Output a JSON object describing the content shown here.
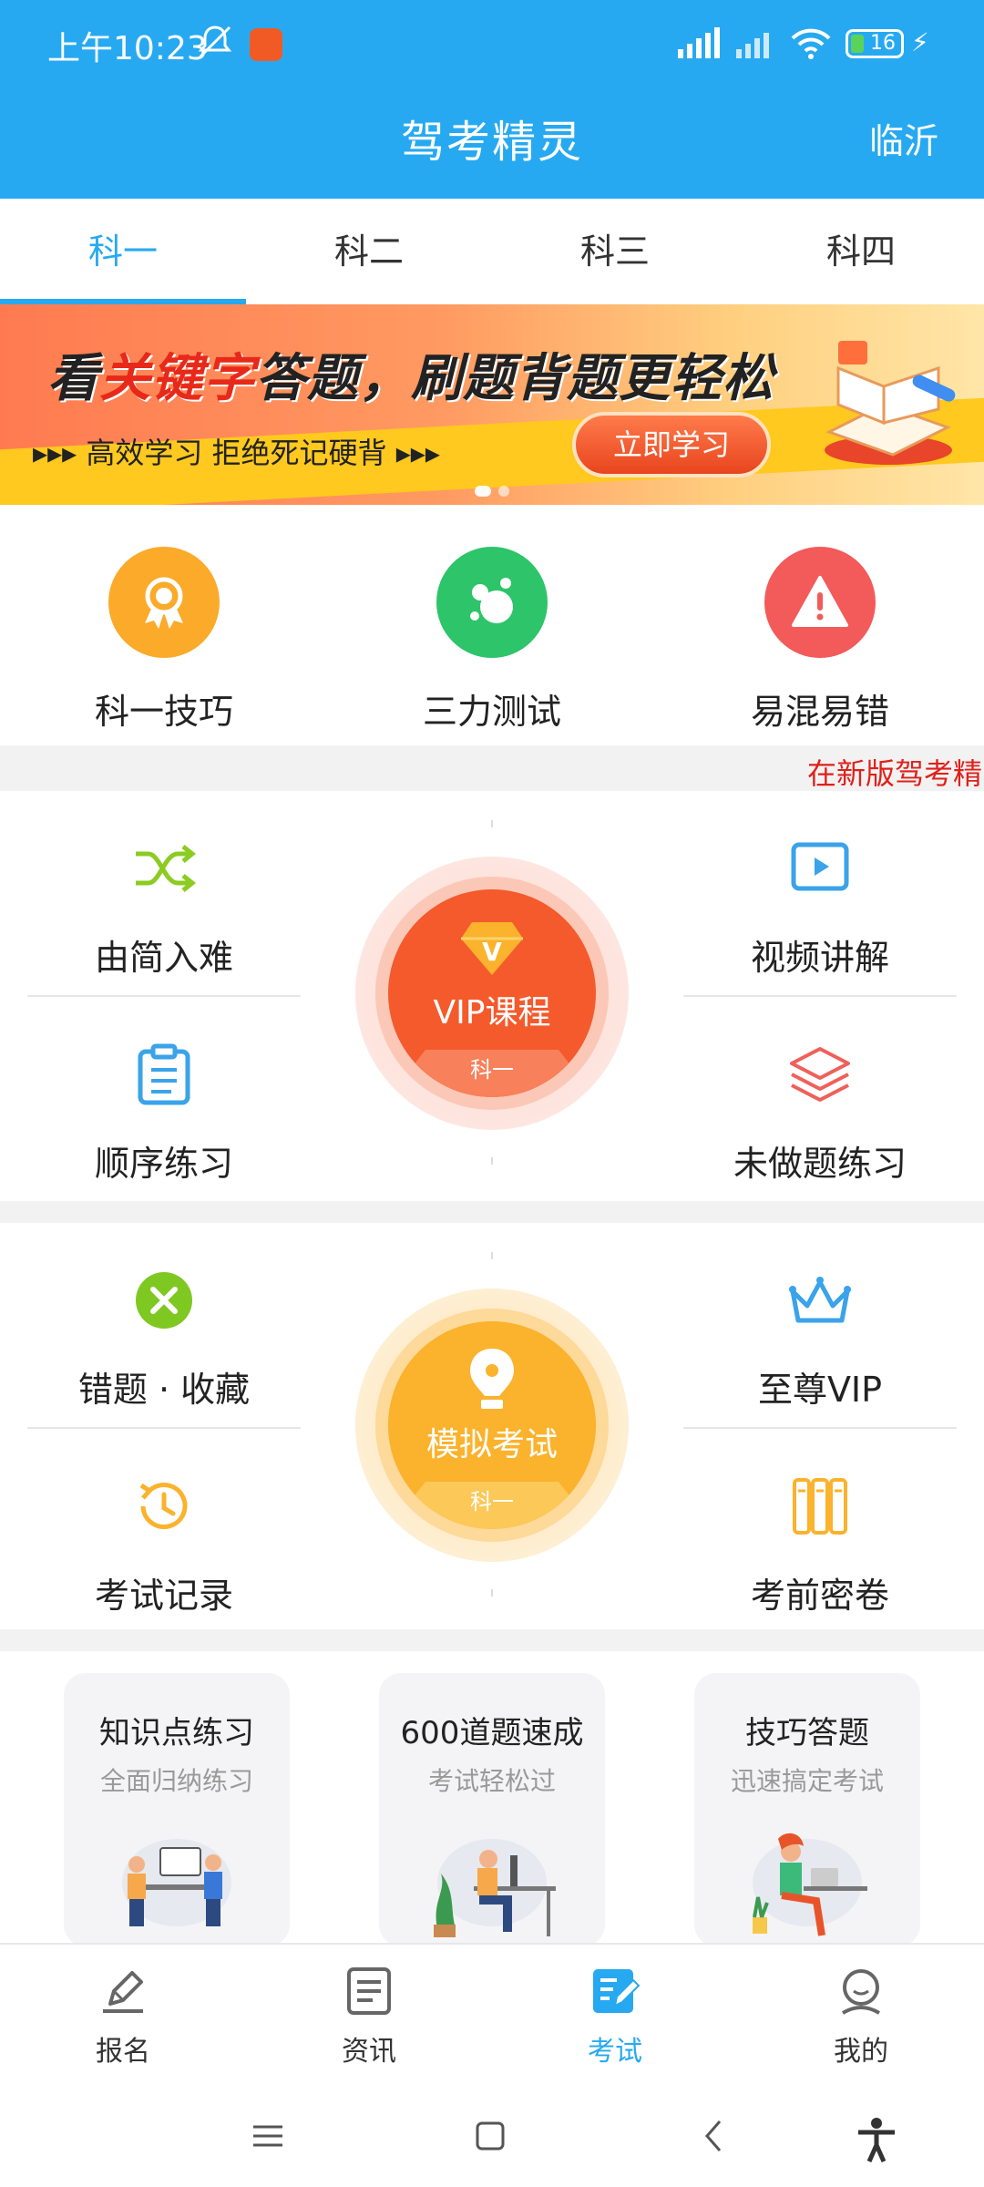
{
  "status_bar": {
    "time": "上午10:23",
    "battery": "16"
  },
  "header": {
    "title": "驾考精灵",
    "city": "临沂"
  },
  "tabs": [
    {
      "label": "科一",
      "active": true
    },
    {
      "label": "科二",
      "active": false
    },
    {
      "label": "科三",
      "active": false
    },
    {
      "label": "科四",
      "active": false
    }
  ],
  "banner": {
    "head_prefix": "看",
    "head_highlight": "关键字",
    "head_suffix": "答题，刷题背题更轻松",
    "sub": "▸▸▸  高效学习  拒绝死记硬背  ▸▸▸",
    "button": "立即学习"
  },
  "quick": [
    {
      "label": "科一技巧",
      "icon": "award-medal-icon",
      "color": "#fbaa2a"
    },
    {
      "label": "三力测试",
      "icon": "bubbles-icon",
      "color": "#2dc46a"
    },
    {
      "label": "易混易错",
      "icon": "warning-triangle-icon",
      "color": "#f35a5a"
    }
  ],
  "marquee": "在新版驾考精",
  "module1": {
    "top_left": "由简入难",
    "bottom_left": "顺序练习",
    "top_right": "视频讲解",
    "bottom_right": "未做题练习",
    "center_title": "VIP课程",
    "center_tag": "科一"
  },
  "module2": {
    "top_left": "错题 · 收藏",
    "bottom_left": "考试记录",
    "top_right": "至尊VIP",
    "bottom_right": "考前密卷",
    "center_title": "模拟考试",
    "center_tag": "科一"
  },
  "cards": [
    {
      "title": "知识点练习",
      "subtitle": "全面归纳练习"
    },
    {
      "title": "600道题速成",
      "subtitle": "考试轻松过"
    },
    {
      "title": "技巧答题",
      "subtitle": "迅速搞定考试"
    }
  ],
  "bottom_nav": [
    {
      "label": "报名",
      "icon": "signup-pen-icon",
      "active": false
    },
    {
      "label": "资讯",
      "icon": "news-doc-icon",
      "active": false
    },
    {
      "label": "考试",
      "icon": "exam-edit-icon",
      "active": true
    },
    {
      "label": "我的",
      "icon": "profile-icon",
      "active": false
    }
  ],
  "colors": {
    "primary": "#27a9f1",
    "vip_orange": "#f55a2c",
    "exam_yellow": "#fbb22c"
  }
}
